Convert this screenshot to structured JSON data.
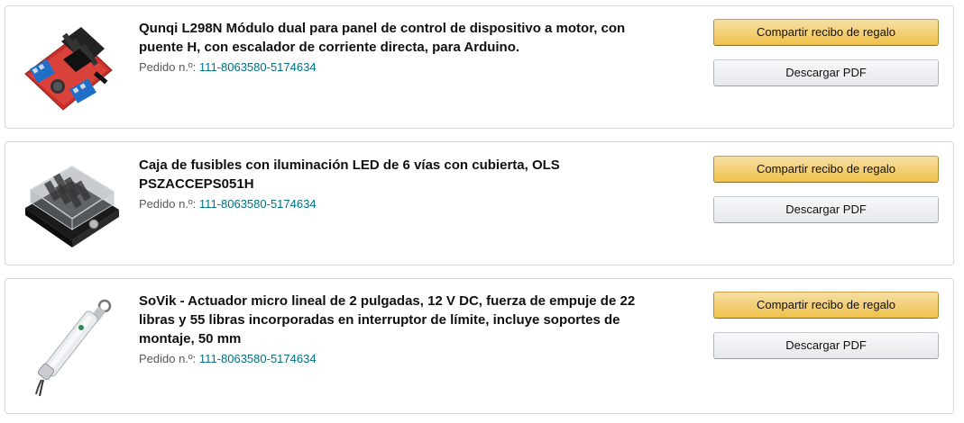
{
  "orders": [
    {
      "title": "Qunqi L298N Módulo dual para panel de control de dispositivo a motor, con puente H, con escalador de corriente directa, para Arduino.",
      "order_label": "Pedido n.º:",
      "order_number": "111-8063580-5174634",
      "share_label": "Compartir recibo de regalo",
      "pdf_label": "Descargar PDF"
    },
    {
      "title": "Caja de fusibles con iluminación LED de 6 vías con cubierta, OLS PSZACCEPS051H",
      "order_label": "Pedido n.º:",
      "order_number": "111-8063580-5174634",
      "share_label": "Compartir recibo de regalo",
      "pdf_label": "Descargar PDF"
    },
    {
      "title": "SoVik - Actuador micro lineal de 2 pulgadas, 12 V DC, fuerza de empuje de 22 libras y 55 libras incorporadas en interruptor de límite, incluye soportes de montaje, 50 mm",
      "order_label": "Pedido n.º:",
      "order_number": "111-8063580-5174634",
      "share_label": "Compartir recibo de regalo",
      "pdf_label": "Descargar PDF"
    }
  ]
}
